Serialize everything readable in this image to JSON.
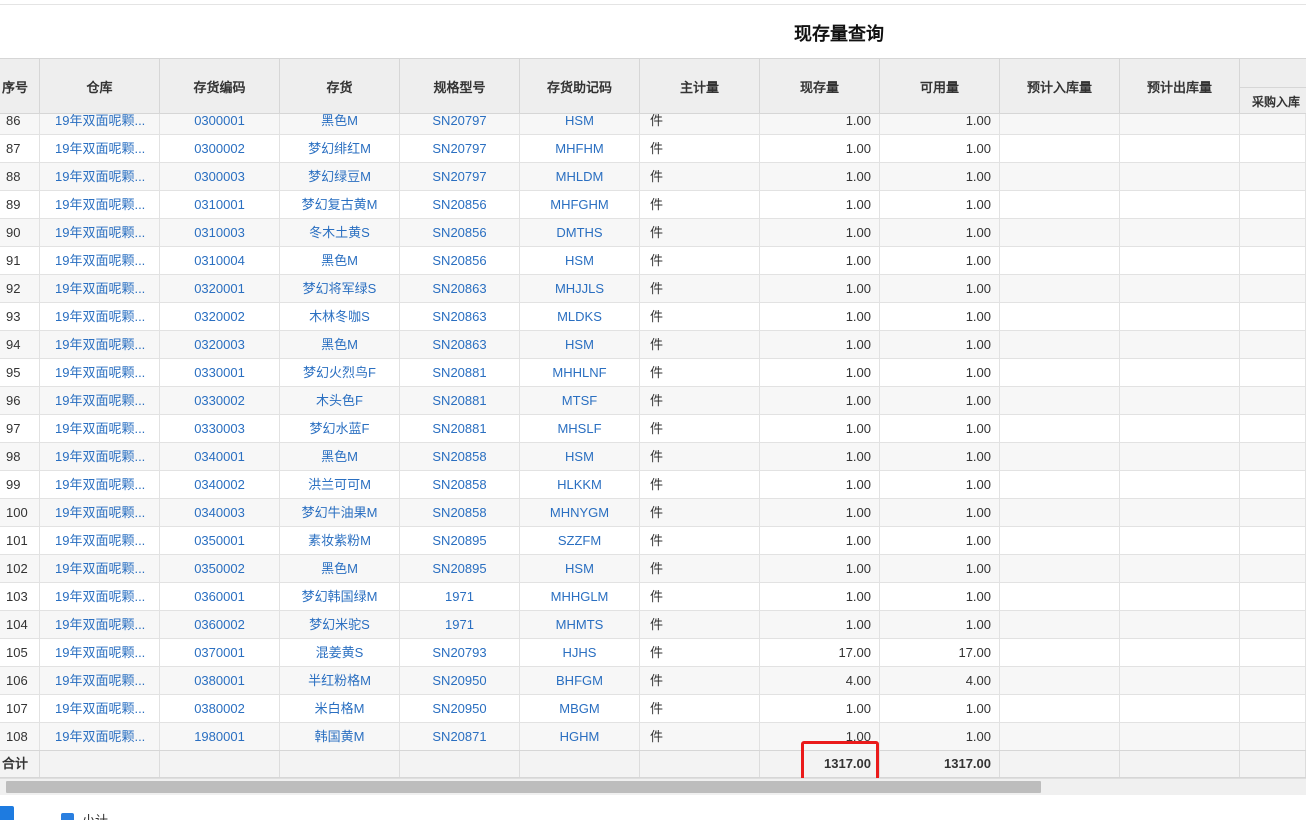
{
  "page_title": "现存量查询",
  "columns": {
    "seq": "序号",
    "warehouse": "仓库",
    "code": "存货编码",
    "name": "存货",
    "spec": "规格型号",
    "mnemonic": "存货助记码",
    "unit": "主计量",
    "on_hand": "现存量",
    "available": "可用量",
    "expected_in": "预计入库量",
    "expected_out": "预计出库量",
    "purchase_in": "采购入库"
  },
  "rows": [
    {
      "seq": "86",
      "warehouse": "19年双面呢颗...",
      "code": "0300001",
      "name": "黑色M",
      "spec": "SN20797",
      "mnemonic": "HSM",
      "unit": "件",
      "on_hand": "1.00",
      "available": "1.00"
    },
    {
      "seq": "87",
      "warehouse": "19年双面呢颗...",
      "code": "0300002",
      "name": "梦幻绯红M",
      "spec": "SN20797",
      "mnemonic": "MHFHM",
      "unit": "件",
      "on_hand": "1.00",
      "available": "1.00"
    },
    {
      "seq": "88",
      "warehouse": "19年双面呢颗...",
      "code": "0300003",
      "name": "梦幻绿豆M",
      "spec": "SN20797",
      "mnemonic": "MHLDM",
      "unit": "件",
      "on_hand": "1.00",
      "available": "1.00"
    },
    {
      "seq": "89",
      "warehouse": "19年双面呢颗...",
      "code": "0310001",
      "name": "梦幻复古黄M",
      "spec": "SN20856",
      "mnemonic": "MHFGHM",
      "unit": "件",
      "on_hand": "1.00",
      "available": "1.00"
    },
    {
      "seq": "90",
      "warehouse": "19年双面呢颗...",
      "code": "0310003",
      "name": "冬木土黄S",
      "spec": "SN20856",
      "mnemonic": "DMTHS",
      "unit": "件",
      "on_hand": "1.00",
      "available": "1.00"
    },
    {
      "seq": "91",
      "warehouse": "19年双面呢颗...",
      "code": "0310004",
      "name": "黑色M",
      "spec": "SN20856",
      "mnemonic": "HSM",
      "unit": "件",
      "on_hand": "1.00",
      "available": "1.00"
    },
    {
      "seq": "92",
      "warehouse": "19年双面呢颗...",
      "code": "0320001",
      "name": "梦幻将军绿S",
      "spec": "SN20863",
      "mnemonic": "MHJJLS",
      "unit": "件",
      "on_hand": "1.00",
      "available": "1.00"
    },
    {
      "seq": "93",
      "warehouse": "19年双面呢颗...",
      "code": "0320002",
      "name": "木林冬咖S",
      "spec": "SN20863",
      "mnemonic": "MLDKS",
      "unit": "件",
      "on_hand": "1.00",
      "available": "1.00"
    },
    {
      "seq": "94",
      "warehouse": "19年双面呢颗...",
      "code": "0320003",
      "name": "黑色M",
      "spec": "SN20863",
      "mnemonic": "HSM",
      "unit": "件",
      "on_hand": "1.00",
      "available": "1.00"
    },
    {
      "seq": "95",
      "warehouse": "19年双面呢颗...",
      "code": "0330001",
      "name": "梦幻火烈鸟F",
      "spec": "SN20881",
      "mnemonic": "MHHLNF",
      "unit": "件",
      "on_hand": "1.00",
      "available": "1.00"
    },
    {
      "seq": "96",
      "warehouse": "19年双面呢颗...",
      "code": "0330002",
      "name": "木头色F",
      "spec": "SN20881",
      "mnemonic": "MTSF",
      "unit": "件",
      "on_hand": "1.00",
      "available": "1.00"
    },
    {
      "seq": "97",
      "warehouse": "19年双面呢颗...",
      "code": "0330003",
      "name": "梦幻水蓝F",
      "spec": "SN20881",
      "mnemonic": "MHSLF",
      "unit": "件",
      "on_hand": "1.00",
      "available": "1.00"
    },
    {
      "seq": "98",
      "warehouse": "19年双面呢颗...",
      "code": "0340001",
      "name": "黑色M",
      "spec": "SN20858",
      "mnemonic": "HSM",
      "unit": "件",
      "on_hand": "1.00",
      "available": "1.00"
    },
    {
      "seq": "99",
      "warehouse": "19年双面呢颗...",
      "code": "0340002",
      "name": "洪兰可可M",
      "spec": "SN20858",
      "mnemonic": "HLKKM",
      "unit": "件",
      "on_hand": "1.00",
      "available": "1.00"
    },
    {
      "seq": "100",
      "warehouse": "19年双面呢颗...",
      "code": "0340003",
      "name": "梦幻牛油果M",
      "spec": "SN20858",
      "mnemonic": "MHNYGM",
      "unit": "件",
      "on_hand": "1.00",
      "available": "1.00"
    },
    {
      "seq": "101",
      "warehouse": "19年双面呢颗...",
      "code": "0350001",
      "name": "素妆紫粉M",
      "spec": "SN20895",
      "mnemonic": "SZZFM",
      "unit": "件",
      "on_hand": "1.00",
      "available": "1.00"
    },
    {
      "seq": "102",
      "warehouse": "19年双面呢颗...",
      "code": "0350002",
      "name": "黑色M",
      "spec": "SN20895",
      "mnemonic": "HSM",
      "unit": "件",
      "on_hand": "1.00",
      "available": "1.00"
    },
    {
      "seq": "103",
      "warehouse": "19年双面呢颗...",
      "code": "0360001",
      "name": "梦幻韩国绿M",
      "spec": "1971",
      "mnemonic": "MHHGLM",
      "unit": "件",
      "on_hand": "1.00",
      "available": "1.00"
    },
    {
      "seq": "104",
      "warehouse": "19年双面呢颗...",
      "code": "0360002",
      "name": "梦幻米驼S",
      "spec": "1971",
      "mnemonic": "MHMTS",
      "unit": "件",
      "on_hand": "1.00",
      "available": "1.00"
    },
    {
      "seq": "105",
      "warehouse": "19年双面呢颗...",
      "code": "0370001",
      "name": "混姜黄S",
      "spec": "SN20793",
      "mnemonic": "HJHS",
      "unit": "件",
      "on_hand": "17.00",
      "available": "17.00"
    },
    {
      "seq": "106",
      "warehouse": "19年双面呢颗...",
      "code": "0380001",
      "name": "半红粉格M",
      "spec": "SN20950",
      "mnemonic": "BHFGM",
      "unit": "件",
      "on_hand": "4.00",
      "available": "4.00"
    },
    {
      "seq": "107",
      "warehouse": "19年双面呢颗...",
      "code": "0380002",
      "name": "米白格M",
      "spec": "SN20950",
      "mnemonic": "MBGM",
      "unit": "件",
      "on_hand": "1.00",
      "available": "1.00"
    },
    {
      "seq": "108",
      "warehouse": "19年双面呢颗...",
      "code": "1980001",
      "name": "韩国黄M",
      "spec": "SN20871",
      "mnemonic": "HGHM",
      "unit": "件",
      "on_hand": "1.00",
      "available": "1.00"
    }
  ],
  "totals": {
    "label": "合计",
    "on_hand": "1317.00",
    "available": "1317.00"
  },
  "footer": {
    "subtotal_label": "小计",
    "subtotal_checked": true
  },
  "colors": {
    "link": "#2a6fc1",
    "header_bg": "#eeeeee",
    "highlight": "#ea1a1a",
    "accent": "#1e7be0"
  }
}
